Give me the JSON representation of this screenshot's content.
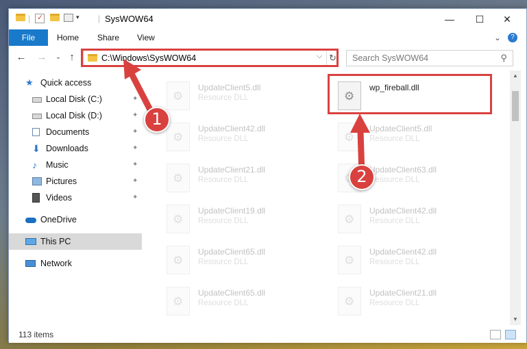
{
  "window": {
    "title": "SysWOW64"
  },
  "title_buttons": {
    "minimize": "—",
    "maximize": "☐",
    "close": "✕"
  },
  "ribbon": {
    "file_tab": "File",
    "tabs": [
      "Home",
      "Share",
      "View"
    ],
    "expand_icon": "⌄",
    "help_icon": "?"
  },
  "address": {
    "path": "C:\\Windows\\SysWOW64",
    "dropdown_icon": "⌵",
    "refresh_icon": "↻"
  },
  "search": {
    "placeholder": "Search SysWOW64",
    "icon": "⚲"
  },
  "nav": {
    "back": "←",
    "forward": "→",
    "recent": "⌄",
    "up": "↑"
  },
  "sidebar": {
    "items": [
      {
        "label": "Quick access",
        "icon": "star-icon"
      },
      {
        "label": "Local Disk (C:)",
        "icon": "drive-icon",
        "pinned": true
      },
      {
        "label": "Local Disk (D:)",
        "icon": "drive-icon",
        "pinned": true
      },
      {
        "label": "Documents",
        "icon": "documents-icon",
        "pinned": true
      },
      {
        "label": "Downloads",
        "icon": "download-icon",
        "pinned": true
      },
      {
        "label": "Music",
        "icon": "music-icon",
        "pinned": true
      },
      {
        "label": "Pictures",
        "icon": "pictures-icon",
        "pinned": true
      },
      {
        "label": "Videos",
        "icon": "videos-icon",
        "pinned": true
      },
      {
        "label": "OneDrive",
        "icon": "cloud-icon"
      },
      {
        "label": "This PC",
        "icon": "computer-icon",
        "selected": true
      },
      {
        "label": "Network",
        "icon": "network-icon"
      }
    ],
    "pin_glyph": "📌"
  },
  "files": {
    "left": [
      {
        "name": "UpdateClient5.dll",
        "type": "Resource DLL"
      },
      {
        "name": "UpdateClient42.dll",
        "type": "Resource DLL"
      },
      {
        "name": "UpdateClient21.dll",
        "type": "Resource DLL"
      },
      {
        "name": "UpdateClient19.dll",
        "type": "Resource DLL"
      },
      {
        "name": "UpdateClient65.dll",
        "type": "Resource DLL"
      },
      {
        "name": "UpdateClient65.dll",
        "type": "Resource DLL"
      }
    ],
    "right": [
      {
        "name": "wp_fireball.dll",
        "type": ""
      },
      {
        "name": "UpdateClient5.dll",
        "type": "Resource DLL"
      },
      {
        "name": "UpdateClient63.dll",
        "type": "Resource DLL"
      },
      {
        "name": "UpdateClient42.dll",
        "type": "Resource DLL"
      },
      {
        "name": "UpdateClient42.dll",
        "type": "Resource DLL"
      },
      {
        "name": "UpdateClient21.dll",
        "type": "Resource DLL"
      }
    ]
  },
  "status": {
    "item_count": "113 items"
  },
  "annotations": {
    "step1": "1",
    "step2": "2",
    "color": "#d9413f"
  }
}
